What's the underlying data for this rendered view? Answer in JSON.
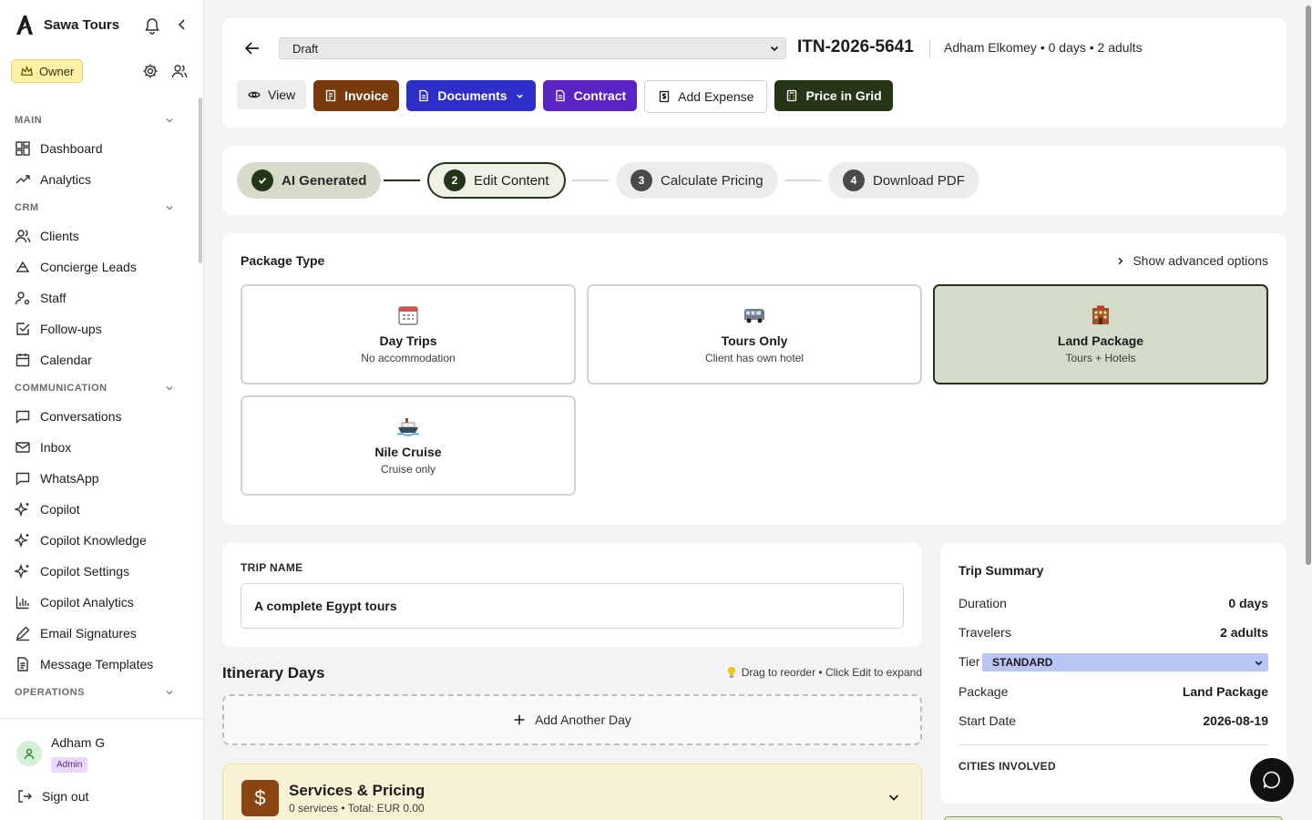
{
  "brand": {
    "name": "Sawa Tours"
  },
  "role": {
    "label": "Owner"
  },
  "nav": {
    "sections": [
      {
        "label": "MAIN",
        "items": [
          "Dashboard",
          "Analytics"
        ]
      },
      {
        "label": "CRM",
        "items": [
          "Clients",
          "Concierge Leads",
          "Staff",
          "Follow-ups",
          "Calendar"
        ]
      },
      {
        "label": "COMMUNICATION",
        "items": [
          "Conversations",
          "Inbox",
          "WhatsApp",
          "Copilot",
          "Copilot Knowledge",
          "Copilot Settings",
          "Copilot Analytics",
          "Email Signatures",
          "Message Templates"
        ]
      },
      {
        "label": "OPERATIONS",
        "items": []
      }
    ]
  },
  "user": {
    "name": "Adham G",
    "role_badge": "Admin",
    "signout": "Sign out"
  },
  "header": {
    "status": "Draft",
    "itinerary_number": "ITN-2026-5641",
    "meta": "Adham Elkomey • 0 days • 2 adults",
    "buttons": {
      "view": "View",
      "invoice": "Invoice",
      "documents": "Documents",
      "contract": "Contract",
      "add_expense": "Add Expense",
      "price_in_grid": "Price in Grid"
    }
  },
  "stepper": {
    "steps": [
      {
        "num": "",
        "label": "AI Generated",
        "state": "done"
      },
      {
        "num": "2",
        "label": "Edit Content",
        "state": "current"
      },
      {
        "num": "3",
        "label": "Calculate Pricing",
        "state": "upcoming"
      },
      {
        "num": "4",
        "label": "Download PDF",
        "state": "upcoming"
      }
    ]
  },
  "package": {
    "title": "Package Type",
    "advanced_link": "Show advanced options",
    "options": [
      {
        "name": "Day Trips",
        "desc": "No accommodation",
        "icon": "calendar-icon",
        "selected": false
      },
      {
        "name": "Tours Only",
        "desc": "Client has own hotel",
        "icon": "minibus-icon",
        "selected": false
      },
      {
        "name": "Land Package",
        "desc": "Tours + Hotels",
        "icon": "hotel-icon",
        "selected": true
      },
      {
        "name": "Nile Cruise",
        "desc": "Cruise only",
        "icon": "ship-icon",
        "selected": false
      }
    ]
  },
  "trip": {
    "label": "TRIP NAME",
    "value": "A complete Egypt tours"
  },
  "days": {
    "title": "Itinerary Days",
    "hint": "Drag to reorder • Click Edit to expand",
    "add_label": "Add Another Day"
  },
  "services": {
    "title": "Services & Pricing",
    "subtitle": "0 services • Total: EUR 0.00",
    "icon_glyph": "$"
  },
  "summary": {
    "title": "Trip Summary",
    "duration_label": "Duration",
    "duration": "0 days",
    "travelers_label": "Travelers",
    "travelers": "2 adults",
    "tier_label": "Tier",
    "tier": "STANDARD",
    "package_label": "Package",
    "package": "Land Package",
    "start_label": "Start Date",
    "start": "2026-08-19",
    "cities_label": "CITIES INVOLVED"
  },
  "colors": {
    "accent_dark_green": "#243419",
    "invoice": "#7a3a0d",
    "documents": "#2d2fc8",
    "contract": "#5b22c4",
    "price_in_grid": "#253515",
    "selected_package_bg": "#d4dbc8"
  }
}
